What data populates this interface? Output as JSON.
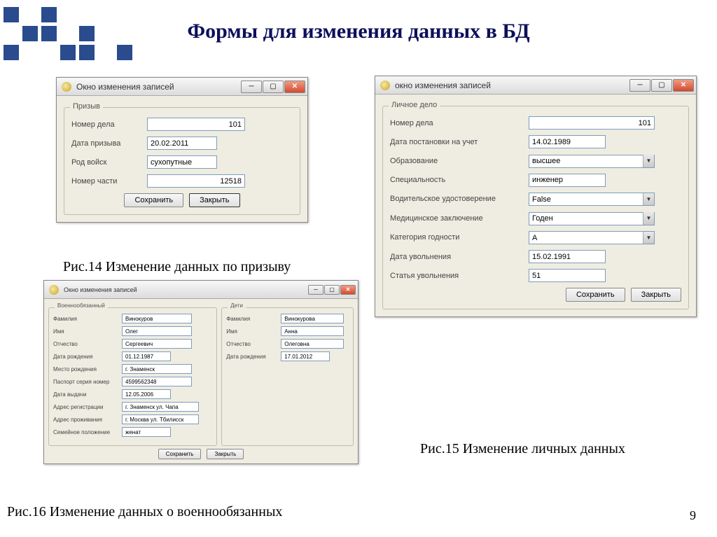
{
  "slide": {
    "title": "Формы для изменения данных в БД",
    "page_number": "9"
  },
  "captions": {
    "fig14": "Рис.14 Изменение  данных по призыву",
    "fig15": "Рис.15 Изменение личных данных",
    "fig16": "Рис.16 Изменение  данных о военнообязанных"
  },
  "window_common": {
    "title": "Окно изменения записей",
    "title_lower": "окно изменения записей",
    "save": "Сохранить",
    "close": "Закрыть"
  },
  "win1": {
    "group": "Призыв",
    "fields": {
      "case_no_label": "Номер дела",
      "case_no": "101",
      "draft_date_label": "Дата призыва",
      "draft_date": "20.02.2011",
      "troop_type_label": "Род войск",
      "troop_type": "сухопутные",
      "unit_no_label": "Номер части",
      "unit_no": "12518"
    }
  },
  "win2": {
    "group": "Личное дело",
    "fields": {
      "case_no_label": "Номер дела",
      "case_no": "101",
      "reg_date_label": "Дата постановки на учет",
      "reg_date": "14.02.1989",
      "education_label": "Образование",
      "education": "высшее",
      "speciality_label": "Специальность",
      "speciality": "инженер",
      "driver_label": "Водительское удостоверение",
      "driver": "False",
      "medical_label": "Медицинское заключение",
      "medical": "Годен",
      "category_label": "Категория годности",
      "category": "А",
      "discharge_date_label": "Дата увольнения",
      "discharge_date": "15.02.1991",
      "discharge_article_label": "Статья увольнения",
      "discharge_article": "51"
    }
  },
  "win3": {
    "group_a": "Военнообязанный",
    "group_b": "Дети",
    "a": {
      "surname_label": "Фамилия",
      "surname": "Винокуров",
      "name_label": "Имя",
      "name": "Олег",
      "patronymic_label": "Отчество",
      "patronymic": "Сергеевич",
      "dob_label": "Дата рождения",
      "dob": "01.12.1987",
      "birthplace_label": "Место рождения",
      "birthplace": "г. Знаменск",
      "passport_label": "Паспорт серия номер",
      "passport": "4599562348",
      "issue_date_label": "Дата выдачи",
      "issue_date": "12.05.2006",
      "reg_addr_label": "Адрес регистрации",
      "reg_addr": "г. Знаменск ул. Чапа",
      "live_addr_label": "Адрес проживания",
      "live_addr": "г. Москва ул. Тбилисск",
      "marital_label": "Семейное положение",
      "marital": "женат"
    },
    "b": {
      "surname_label": "Фамилия",
      "surname": "Винокурова",
      "name_label": "Имя",
      "name": "Анна",
      "patronymic_label": "Отчество",
      "patronymic": "Олеговна",
      "dob_label": "Дата рождения",
      "dob": "17.01.2012"
    }
  }
}
